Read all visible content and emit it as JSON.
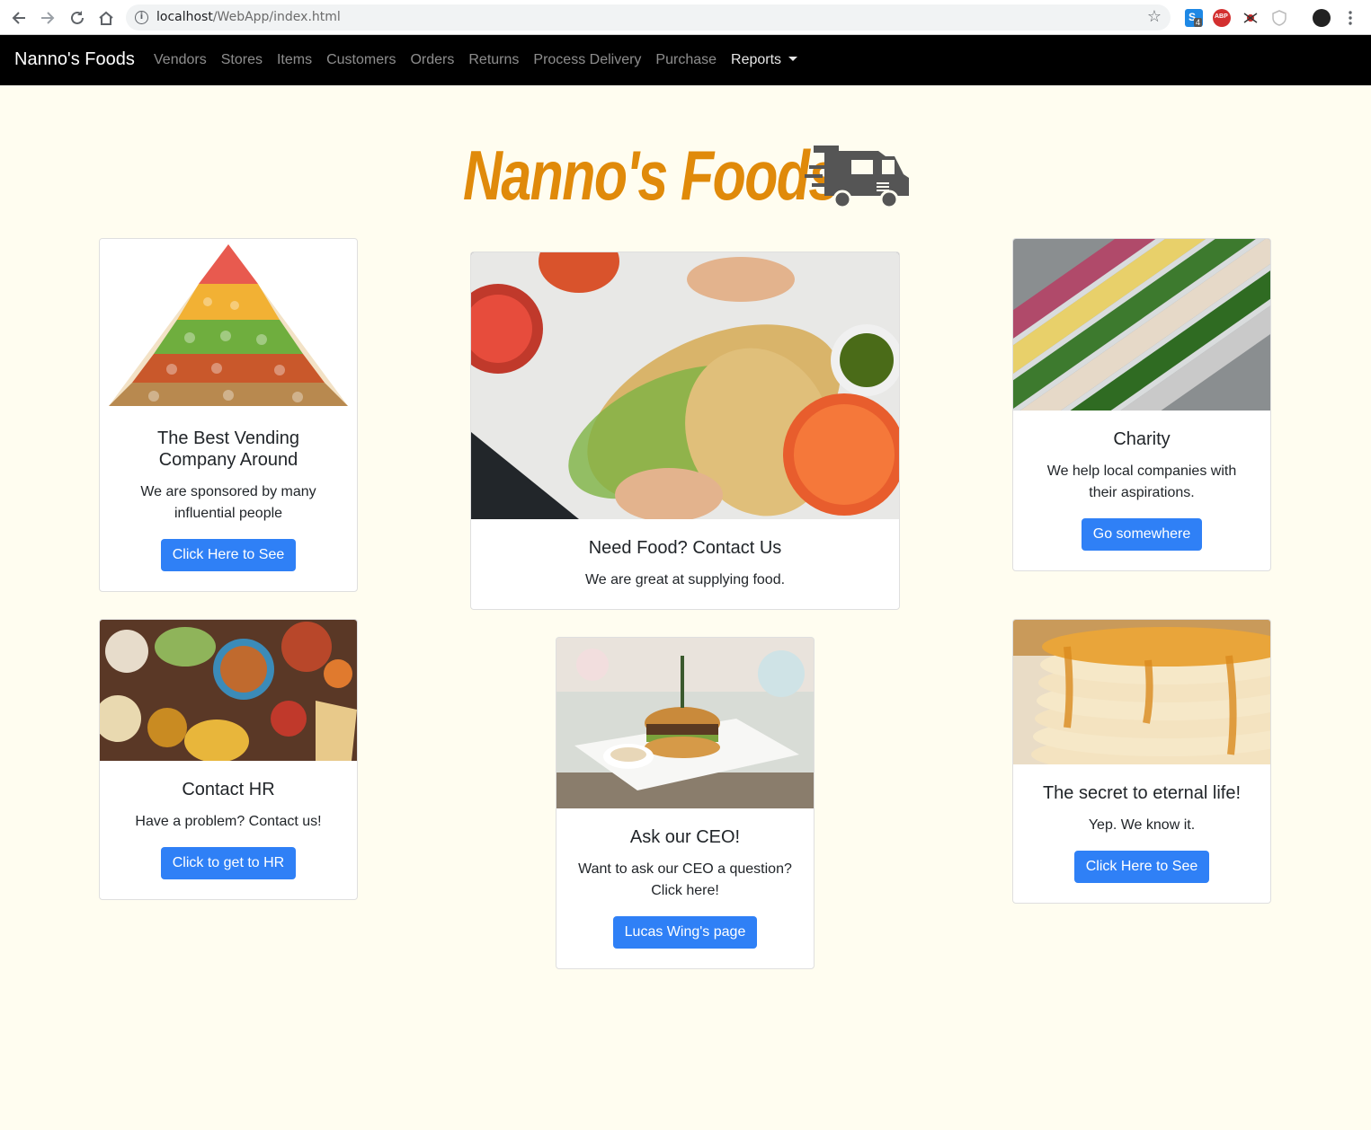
{
  "browser": {
    "url_host": "localhost",
    "url_path": "/WebApp/index.html",
    "ext_badge": "4"
  },
  "navbar": {
    "brand": "Nanno's Foods",
    "links": [
      "Vendors",
      "Stores",
      "Items",
      "Customers",
      "Orders",
      "Returns",
      "Process Delivery",
      "Purchase"
    ],
    "dropdown_label": "Reports"
  },
  "logo": {
    "text": "Nanno's Foods"
  },
  "cards": {
    "vending": {
      "title": "The Best Vending Company Around",
      "text": "We are sponsored by many influential people",
      "button": "Click Here to See"
    },
    "need_food": {
      "title": "Need Food? Contact Us",
      "text": "We are great at supplying food."
    },
    "charity": {
      "title": "Charity",
      "text": "We help local companies with their aspirations.",
      "button": "Go somewhere"
    },
    "contact_hr": {
      "title": "Contact HR",
      "text": "Have a problem? Contact us!",
      "button": "Click to get to HR"
    },
    "ceo": {
      "title": "Ask our CEO!",
      "text": "Want to ask our CEO a question? Click here!",
      "button": "Lucas Wing's page"
    },
    "secret": {
      "title": "The secret to eternal life!",
      "text": "Yep. We know it.",
      "button": "Click Here to See"
    }
  },
  "colors": {
    "page_bg": "#fffdf0",
    "navbar_bg": "#000000",
    "logo_orange": "#e08a0a",
    "button_blue": "#2f80f6"
  }
}
